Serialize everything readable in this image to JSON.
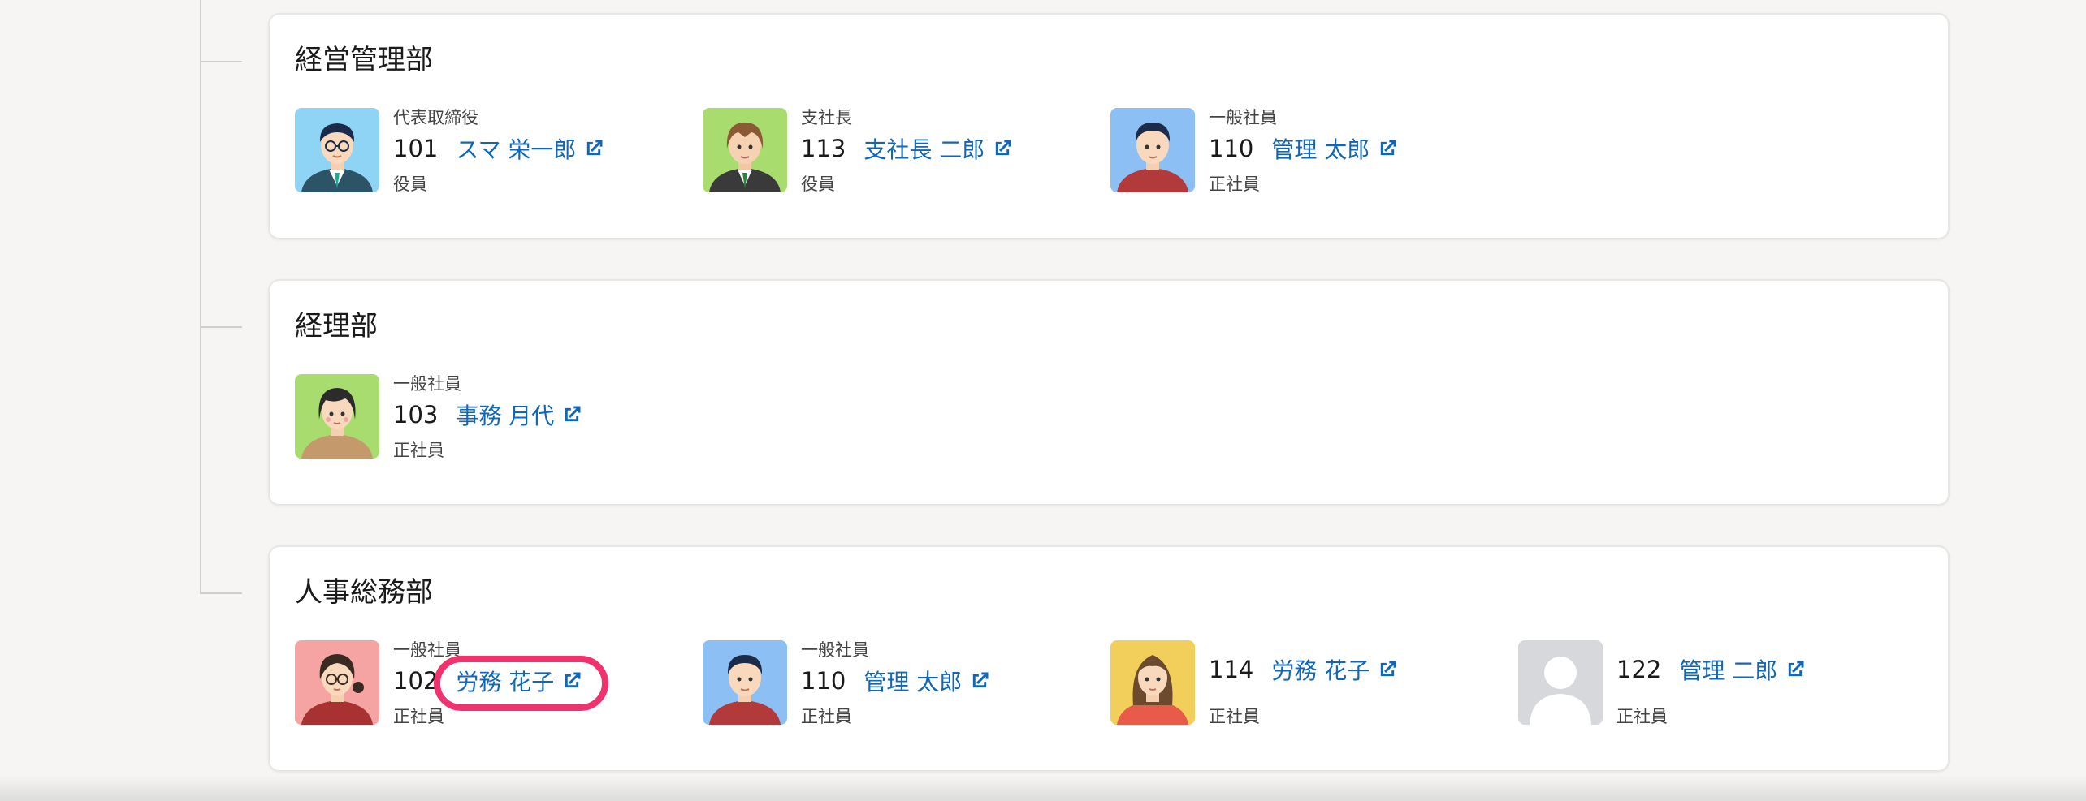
{
  "departments": [
    {
      "title": "経営管理部",
      "members": [
        {
          "role": "代表取締役",
          "number": "101",
          "name": "スマ 栄一郎",
          "type": "役員",
          "avatar": "avatar-man-glasses-suit"
        },
        {
          "role": "支社長",
          "number": "113",
          "name": "支社長 二郎",
          "type": "役員",
          "avatar": "avatar-man-suit"
        },
        {
          "role": "一般社員",
          "number": "110",
          "name": "管理 太郎",
          "type": "正社員",
          "avatar": "avatar-man-red"
        }
      ]
    },
    {
      "title": "経理部",
      "members": [
        {
          "role": "一般社員",
          "number": "103",
          "name": "事務 月代",
          "type": "正社員",
          "avatar": "avatar-woman-short-hair"
        }
      ]
    },
    {
      "title": "人事総務部",
      "members": [
        {
          "role": "一般社員",
          "number": "102",
          "name": "労務 花子",
          "type": "正社員",
          "avatar": "avatar-woman-glasses"
        },
        {
          "role": "一般社員",
          "number": "110",
          "name": "管理 太郎",
          "type": "正社員",
          "avatar": "avatar-man-red"
        },
        {
          "role": "",
          "number": "114",
          "name": "労務 花子",
          "type": "正社員",
          "avatar": "avatar-woman-long-hair"
        },
        {
          "role": "",
          "number": "122",
          "name": "管理 二郎",
          "type": "正社員",
          "avatar": "avatar-placeholder"
        }
      ]
    }
  ],
  "colors": {
    "link": "#1066b8",
    "highlight": "#f0336e",
    "background": "#f6f5f3"
  },
  "icons": {
    "external_link": "external-link-icon"
  }
}
